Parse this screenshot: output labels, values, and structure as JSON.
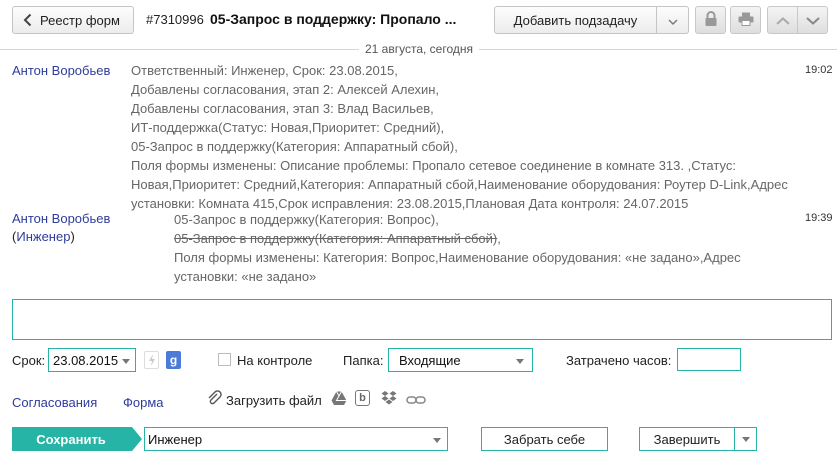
{
  "header": {
    "back_label": "Реестр форм",
    "task_number": "#7310996",
    "task_title": "05-Запрос в поддержку: Пропало ...",
    "add_subtask_label": "Добавить подзадачу"
  },
  "date_divider": "21 августа, сегодня",
  "entries": [
    {
      "author": "Антон Воробьев",
      "time": "19:02",
      "lines": [
        "Ответственный: Инженер, Срок: 23.08.2015,",
        "Добавлены согласования, этап 2: Алексей Алехин,",
        "Добавлены согласования, этап 3: Влад Васильев,",
        "ИТ-поддержка(Статус: Новая,Приоритет: Средний),",
        "05-Запрос в поддержку(Категория: Аппаратный сбой),",
        "Поля формы изменены: Описание проблемы: Пропало сетевое соединение в комнате 313. ,Статус: Новая,Приоритет: Средний,Категория: Аппаратный сбой,Наименование оборудования: Роутер D-Link,Адрес установки: Комната 415,Срок исправления: 23.08.2015,Плановая Дата контроля: 24.07.2015"
      ]
    },
    {
      "author": "Антон Воробьев",
      "role": "Инженер",
      "time": "19:39",
      "lines": [
        "05-Запрос в поддержку(Категория: Вопрос),",
        "05-Запрос в поддержку(Категория: Аппаратный сбой)",
        "Поля формы изменены: Категория: Вопрос,Наименование оборудования: «не задано»,Адрес установки: «не задано»"
      ]
    }
  ],
  "form": {
    "deadline_label": "Срок:",
    "deadline_value": "23.08.2015",
    "control_label": "На контроле",
    "folder_label": "Папка:",
    "folder_value": "Входящие",
    "hours_label": "Затрачено часов:",
    "hours_value": ""
  },
  "links": {
    "approvals": "Согласования",
    "form": "Форма",
    "upload": "Загрузить файл"
  },
  "actions": {
    "save": "Сохранить",
    "assignee": "Инженер",
    "take": "Забрать себе",
    "finish": "Завершить"
  },
  "colors": {
    "accent": "#25b4a5",
    "link": "#2e3c9b"
  }
}
